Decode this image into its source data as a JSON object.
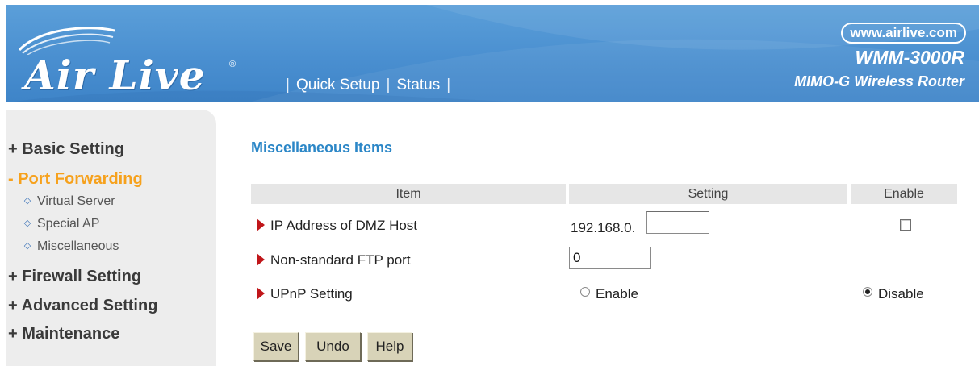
{
  "header": {
    "brand": "Air Live",
    "registered_mark": "®",
    "site_url": "www.airlive.com",
    "model": "WMM-3000R",
    "subtitle": "MIMO-G Wireless Router",
    "nav": {
      "separator": "|",
      "quick_setup": "Quick Setup",
      "status": "Status"
    }
  },
  "sidebar": {
    "items": [
      {
        "label": "+ Basic Setting",
        "active": false
      },
      {
        "label": "- Port Forwarding",
        "active": true
      },
      {
        "label": "+ Firewall Setting",
        "active": false
      },
      {
        "label": "+ Advanced Setting",
        "active": false
      },
      {
        "label": "+ Maintenance",
        "active": false
      }
    ],
    "subitems": [
      {
        "label": "Virtual Server",
        "icon": "diamond-bullet-icon"
      },
      {
        "label": "Special AP",
        "icon": "diamond-bullet-icon"
      },
      {
        "label": "Miscellaneous",
        "icon": "diamond-bullet-icon"
      }
    ]
  },
  "main": {
    "title": "Miscellaneous Items",
    "table": {
      "headers": {
        "item": "Item",
        "setting": "Setting",
        "enable": "Enable"
      },
      "rows": {
        "dmz": {
          "label": "IP Address of DMZ Host",
          "ip_prefix": "192.168.0.",
          "value": "",
          "enabled": false
        },
        "ftp": {
          "label": "Non-standard FTP port",
          "value": "0"
        },
        "upnp": {
          "label": "UPnP Setting",
          "option_enable": "Enable",
          "option_disable": "Disable",
          "selected": "Disable"
        }
      }
    },
    "buttons": {
      "save": "Save",
      "undo": "Undo",
      "help": "Help"
    }
  },
  "colors": {
    "header_blue": "#4a8fd0",
    "accent_orange": "#f6a11c",
    "title_blue": "#2c87c7",
    "bullet_red": "#c0161a",
    "button_beige": "#d8d3b8"
  }
}
